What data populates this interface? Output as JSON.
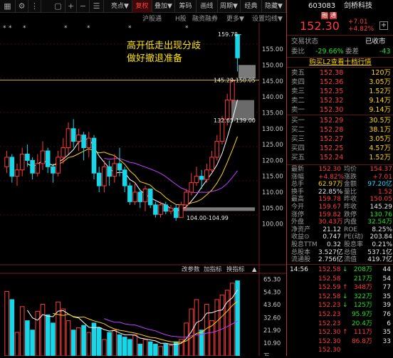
{
  "toolbar": {
    "icons": [
      "grid-icon",
      "plus-icon",
      "minus-icon",
      "list-icon"
    ],
    "items": [
      "亮点▼",
      "复权",
      "叠加▼",
      "筹码",
      "画线",
      "周期▼",
      "经典",
      "隐藏▼"
    ],
    "active_item": "复权"
  },
  "subtabs": [
    "沪股通",
    "H股",
    "融资融券",
    "更多▼",
    "设置均线▼"
  ],
  "annotation": {
    "line1": "高开低走出现分歧",
    "line2": "做好撤退准备"
  },
  "price_labels": {
    "high": "159.78 -",
    "zone1": "145.29-150.05",
    "zone2": "132.65-139.00",
    "low": "104.00-104.99"
  },
  "price_axis": [
    "155.00",
    "150.00",
    "145.00",
    "140.00",
    "135.00",
    "130.00",
    "125.00",
    "120.00",
    "115.00",
    "110.00",
    "105.00",
    "100.00"
  ],
  "volume_toolbar": [
    "改参数",
    "加指标",
    "换指标",
    "▲"
  ],
  "volume_axis": [
    "65.30",
    "54.30",
    "43.60",
    "32.60",
    "21.90",
    "10.90",
    "万"
  ],
  "stock": {
    "code": "603083",
    "name": "剑桥科技",
    "tags": [
      "融",
      "通"
    ],
    "price": "152.30",
    "change": "+7.01",
    "pct": "+4.82%"
  },
  "status": {
    "label": "交易状态",
    "value": "已收市"
  },
  "ratio": {
    "wb_label": "委比",
    "wb_value": "-29.66%",
    "wc_label": "委差",
    "wc_value": "-43"
  },
  "l2_banner": "购买L2查看十档行情",
  "asks": [
    {
      "label": "卖五",
      "price": "152.38",
      "vol": "120万"
    },
    {
      "label": "卖四",
      "price": "152.36",
      "vol": "3.05万"
    },
    {
      "label": "卖三",
      "price": "152.35",
      "vol": "1.52万"
    },
    {
      "label": "卖二",
      "price": "152.32",
      "vol": "9.14万"
    },
    {
      "label": "卖一",
      "price": "152.30",
      "vol": "9.14万"
    }
  ],
  "bids": [
    {
      "label": "买一",
      "price": "152.29",
      "vol": "30.5万"
    },
    {
      "label": "买二",
      "price": "152.28",
      "vol": "38.1万"
    },
    {
      "label": "买三",
      "price": "152.27",
      "vol": "3.05万"
    },
    {
      "label": "买四",
      "price": "152.25",
      "vol": "4.57万"
    },
    {
      "label": "买五",
      "price": "152.24",
      "vol": "1.52万"
    }
  ],
  "stats": [
    {
      "l1": "最新",
      "v1": "152.30",
      "c1": "red",
      "l2": "均价",
      "v2": "154.37",
      "c2": "red"
    },
    {
      "l1": "涨幅",
      "v1": "+4.82%",
      "c1": "red",
      "l2": "涨跌",
      "v2": "+7.01",
      "c2": "red"
    },
    {
      "l1": "总手",
      "v1": "62.97万",
      "c1": "yellow",
      "l2": "金额",
      "v2": "97.20亿",
      "c2": "cyan"
    },
    {
      "l1": "换手",
      "v1": "22.85%",
      "c1": "white",
      "l2": "量比",
      "v2": "1.52",
      "c2": "red"
    },
    {
      "l1": "最高",
      "v1": "159.78",
      "c1": "red",
      "l2": "昨收",
      "v2": "150.05",
      "c2": "red"
    },
    {
      "l1": "今开",
      "v1": "159.67",
      "c1": "red",
      "l2": "昨收",
      "v2": "145.29",
      "c2": "white"
    },
    {
      "l1": "涨停",
      "v1": "159.82",
      "c1": "red",
      "l2": "跌停",
      "v2": "130.76",
      "c2": "green"
    },
    {
      "l1": "外盘",
      "v1": "30.43万",
      "c1": "red",
      "l2": "内盘",
      "v2": "32.54万",
      "c2": "green"
    },
    {
      "l1": "净资产",
      "v1": "21.12",
      "c1": "white",
      "l2": "ROE",
      "v2": "8.25%",
      "c2": "white"
    },
    {
      "l1": "收益⊙",
      "v1": "0.747",
      "c1": "white",
      "l2": "PE(动)",
      "v2": "203.84",
      "c2": "white"
    },
    {
      "l1": "股息TTM",
      "v1": "0.32",
      "c1": "white",
      "l2": "股息率",
      "v2": "0.21%",
      "c2": "white"
    },
    {
      "l1": "总股本",
      "v1": "3.527亿",
      "c1": "white",
      "l2": "总值",
      "v2": "537.1亿",
      "c2": "white"
    },
    {
      "l1": "流通股",
      "v1": "2.756亿",
      "c1": "white",
      "l2": "流值",
      "v2": "419.7亿",
      "c2": "white"
    }
  ],
  "ticks": [
    {
      "time": "14:56",
      "price": "152.58",
      "arrow": "↓",
      "vol": "208万",
      "vc": "green",
      "n": "44"
    },
    {
      "time": "",
      "price": "152.58",
      "arrow": "",
      "vol": "217万",
      "vc": "green",
      "n": "54"
    },
    {
      "time": "",
      "price": "152.59",
      "arrow": "↑",
      "vol": "348万",
      "vc": "red",
      "n": "77"
    },
    {
      "time": "",
      "price": "152.58",
      "arrow": "↓",
      "vol": "322万",
      "vc": "green",
      "n": "35"
    },
    {
      "time": "",
      "price": "152.23",
      "arrow": "↓",
      "vol": "125万",
      "vc": "green",
      "n": "39"
    },
    {
      "time": "",
      "price": "152.23",
      "arrow": "",
      "vol": "95.9万",
      "vc": "green",
      "n": "76"
    },
    {
      "time": "",
      "price": "152.23",
      "arrow": "",
      "vol": "20.4万",
      "vc": "green",
      "n": "6"
    },
    {
      "time": "",
      "price": "152.30",
      "arrow": "↑",
      "vol": "111万",
      "vc": "red",
      "n": "35"
    },
    {
      "time": "",
      "price": "152.30",
      "arrow": "",
      "vol": "86.8万",
      "vc": "red",
      "n": "33"
    },
    {
      "time": "",
      "price": "152.30",
      "arrow": "",
      "vol": "",
      "vc": "red",
      "n": ""
    }
  ],
  "colors": {
    "up": "#ff3b3b",
    "down": "#17d6e8",
    "ma5": "#ffffff",
    "ma10": "#ffd400",
    "ma20": "#c040ff",
    "bg": "#000000"
  },
  "kline": [
    {
      "o": 118,
      "c": 121,
      "h": 123,
      "l": 116
    },
    {
      "o": 121,
      "c": 115,
      "h": 122,
      "l": 113
    },
    {
      "o": 115,
      "c": 117,
      "h": 119,
      "l": 112
    },
    {
      "o": 117,
      "c": 122,
      "h": 124,
      "l": 115
    },
    {
      "o": 122,
      "c": 120,
      "h": 125,
      "l": 118
    },
    {
      "o": 120,
      "c": 116,
      "h": 121,
      "l": 114
    },
    {
      "o": 116,
      "c": 119,
      "h": 122,
      "l": 115
    },
    {
      "o": 119,
      "c": 123,
      "h": 126,
      "l": 117
    },
    {
      "o": 123,
      "c": 118,
      "h": 124,
      "l": 116
    },
    {
      "o": 118,
      "c": 116,
      "h": 119,
      "l": 113
    },
    {
      "o": 116,
      "c": 121,
      "h": 123,
      "l": 115
    },
    {
      "o": 121,
      "c": 124,
      "h": 127,
      "l": 119
    },
    {
      "o": 124,
      "c": 130,
      "h": 132,
      "l": 122
    },
    {
      "o": 130,
      "c": 126,
      "h": 133,
      "l": 124
    },
    {
      "o": 126,
      "c": 128,
      "h": 130,
      "l": 123
    },
    {
      "o": 128,
      "c": 124,
      "h": 129,
      "l": 120
    },
    {
      "o": 124,
      "c": 127,
      "h": 129,
      "l": 121
    },
    {
      "o": 127,
      "c": 116,
      "h": 128,
      "l": 114
    },
    {
      "o": 116,
      "c": 112,
      "h": 118,
      "l": 110
    },
    {
      "o": 112,
      "c": 118,
      "h": 120,
      "l": 110
    },
    {
      "o": 118,
      "c": 115,
      "h": 120,
      "l": 112
    },
    {
      "o": 115,
      "c": 119,
      "h": 122,
      "l": 113
    },
    {
      "o": 119,
      "c": 117,
      "h": 124,
      "l": 115
    },
    {
      "o": 117,
      "c": 112,
      "h": 118,
      "l": 110
    },
    {
      "o": 112,
      "c": 107,
      "h": 113,
      "l": 106
    },
    {
      "o": 107,
      "c": 110,
      "h": 113,
      "l": 106
    },
    {
      "o": 110,
      "c": 107,
      "h": 111,
      "l": 105
    },
    {
      "o": 107,
      "c": 111,
      "h": 112,
      "l": 104
    },
    {
      "o": 111,
      "c": 106,
      "h": 111,
      "l": 105
    },
    {
      "o": 106,
      "c": 103,
      "h": 107,
      "l": 102
    },
    {
      "o": 103,
      "c": 106,
      "h": 107,
      "l": 102
    },
    {
      "o": 106,
      "c": 104,
      "h": 107,
      "l": 103
    },
    {
      "o": 104,
      "c": 105,
      "h": 106,
      "l": 103
    },
    {
      "o": 105,
      "c": 102,
      "h": 106,
      "l": 101
    },
    {
      "o": 102,
      "c": 106,
      "h": 107,
      "l": 102
    },
    {
      "o": 106,
      "c": 110,
      "h": 111,
      "l": 104
    },
    {
      "o": 110,
      "c": 113,
      "h": 116,
      "l": 109
    },
    {
      "o": 113,
      "c": 115,
      "h": 118,
      "l": 112
    },
    {
      "o": 115,
      "c": 114,
      "h": 117,
      "l": 111
    },
    {
      "o": 114,
      "c": 117,
      "h": 119,
      "l": 113
    },
    {
      "o": 117,
      "c": 121,
      "h": 123,
      "l": 116
    },
    {
      "o": 121,
      "c": 126,
      "h": 128,
      "l": 120
    },
    {
      "o": 126,
      "c": 133,
      "h": 134,
      "l": 125
    },
    {
      "o": 133,
      "c": 139,
      "h": 141,
      "l": 131
    },
    {
      "o": 139,
      "c": 145,
      "h": 146,
      "l": 138
    },
    {
      "o": 159.67,
      "c": 152.3,
      "h": 159.78,
      "l": 148
    }
  ],
  "volumes": [
    55,
    48,
    20,
    42,
    30,
    22,
    38,
    44,
    35,
    28,
    46,
    40,
    30,
    22,
    24,
    26,
    20,
    28,
    24,
    14,
    20,
    22,
    18,
    16,
    14,
    18,
    10,
    14,
    12,
    10,
    8,
    10,
    9,
    12,
    14,
    28,
    40,
    48,
    22,
    44,
    30,
    48,
    52,
    56,
    62,
    64
  ]
}
